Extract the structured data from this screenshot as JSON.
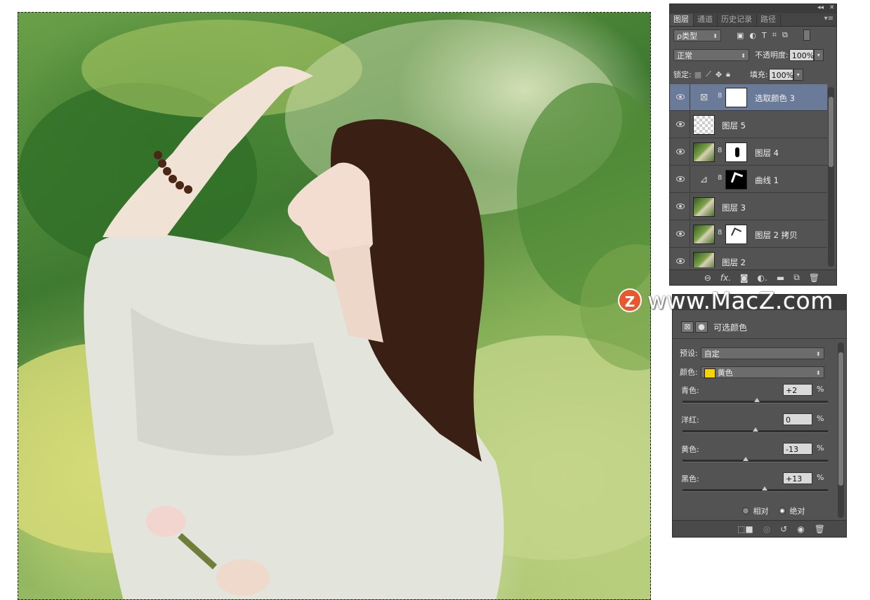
{
  "layers_panel": {
    "tabs": [
      "图层",
      "通道",
      "历史记录",
      "路径"
    ],
    "filter_kind": "ρ类型",
    "blend_mode": "正常",
    "opacity_label": "不透明度:",
    "opacity_value": "100%",
    "lock_label": "锁定:",
    "fill_label": "填充:",
    "fill_value": "100%",
    "layers": [
      {
        "name": "选取颜色 3",
        "selected": true
      },
      {
        "name": "图层 5",
        "selected": false
      },
      {
        "name": "图层 4",
        "selected": false
      },
      {
        "name": "曲线 1",
        "selected": false
      },
      {
        "name": "图层 3",
        "selected": false
      },
      {
        "name": "图层 2 拷贝",
        "selected": false
      },
      {
        "name": "图层 2",
        "selected": false
      }
    ],
    "bottom_icons": [
      "link-icon",
      "fx-icon",
      "mask-icon",
      "adjustment-icon",
      "folder-icon",
      "new-layer-icon",
      "trash-icon"
    ]
  },
  "properties_panel": {
    "title": "可选颜色",
    "preset_label": "预设:",
    "preset_value": "自定",
    "color_label": "颜色:",
    "color_value": "黄色",
    "color_swatch": "#f5d400",
    "sliders": [
      {
        "label": "青色:",
        "value": "+2",
        "pct": "%",
        "pos": 0.51
      },
      {
        "label": "洋红:",
        "value": "0",
        "pct": "%",
        "pos": 0.5
      },
      {
        "label": "黄色:",
        "value": "-13",
        "pct": "%",
        "pos": 0.435
      },
      {
        "label": "黑色:",
        "value": "+13",
        "pct": "%",
        "pos": 0.565
      }
    ],
    "method_relative": "相对",
    "method_absolute": "绝对",
    "method_selected": "绝对"
  },
  "watermark": {
    "logo_letter": "Z",
    "text": "www.MacZ.com"
  }
}
